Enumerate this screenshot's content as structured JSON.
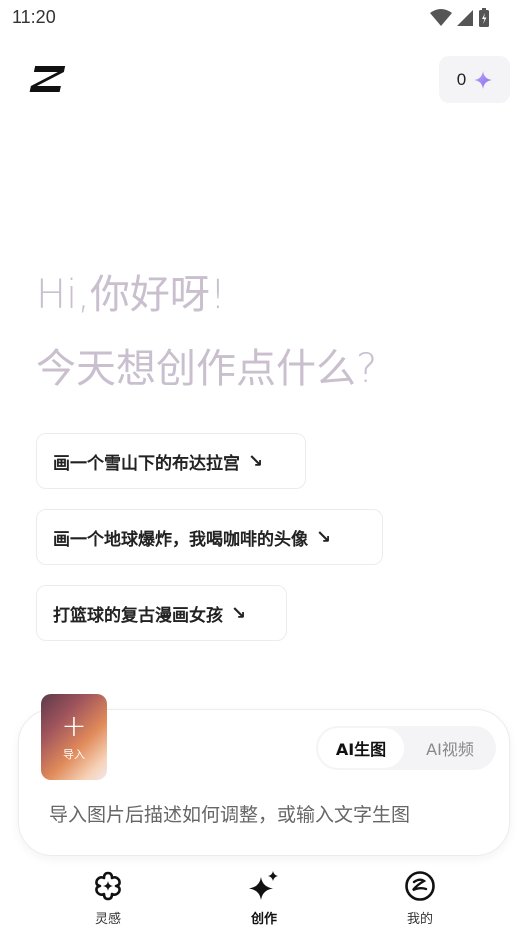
{
  "status_bar": {
    "time": "11:20"
  },
  "header": {
    "credits": "0"
  },
  "greeting": {
    "line1": "Hi,你好呀!",
    "line2": "今天想创作点什么?"
  },
  "suggestions": [
    {
      "text": "画一个雪山下的布达拉宫",
      "arrow": "↘"
    },
    {
      "text": "画一个地球爆炸，我喝咖啡的头像",
      "arrow": "↘"
    },
    {
      "text": "打篮球的复古漫画女孩",
      "arrow": "↘"
    }
  ],
  "composer": {
    "import_label": "导入",
    "modes": {
      "selected": "AI生图",
      "other": "AI视频"
    },
    "placeholder": "导入图片后描述如何调整，或输入文字生图"
  },
  "bottom_nav": [
    {
      "label": "灵感",
      "icon": "inspiration-icon",
      "active": false
    },
    {
      "label": "创作",
      "icon": "sparkle-create-icon",
      "active": true
    },
    {
      "label": "我的",
      "icon": "profile-icon",
      "active": false
    }
  ],
  "colors": {
    "greeting": "#c9bfcf",
    "sparkle_accent": "#9b7cf0"
  }
}
